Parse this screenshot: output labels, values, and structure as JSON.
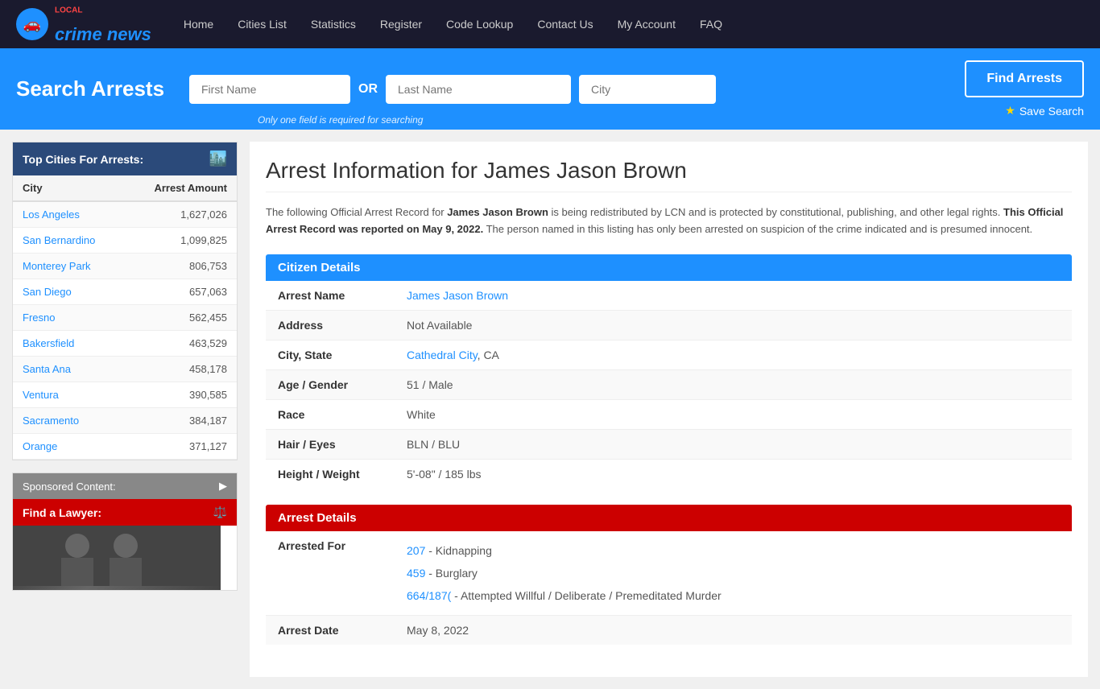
{
  "nav": {
    "logo_text": "crime news",
    "logo_local": "LOCAL",
    "links": [
      {
        "label": "Home",
        "href": "#"
      },
      {
        "label": "Cities List",
        "href": "#"
      },
      {
        "label": "Statistics",
        "href": "#"
      },
      {
        "label": "Register",
        "href": "#"
      },
      {
        "label": "Code Lookup",
        "href": "#"
      },
      {
        "label": "Contact Us",
        "href": "#"
      },
      {
        "label": "My Account",
        "href": "#"
      },
      {
        "label": "FAQ",
        "href": "#"
      }
    ]
  },
  "search": {
    "title": "Search Arrests",
    "first_name_placeholder": "First Name",
    "last_name_placeholder": "Last Name",
    "city_placeholder": "City",
    "or_label": "OR",
    "note": "Only one field is required for searching",
    "find_button": "Find Arrests",
    "save_label": "Save Search"
  },
  "sidebar": {
    "top_cities_header": "Top Cities For Arrests:",
    "col_city": "City",
    "col_amount": "Arrest Amount",
    "cities": [
      {
        "name": "Los Angeles",
        "amount": "1,627,026"
      },
      {
        "name": "San Bernardino",
        "amount": "1,099,825"
      },
      {
        "name": "Monterey Park",
        "amount": "806,753"
      },
      {
        "name": "San Diego",
        "amount": "657,063"
      },
      {
        "name": "Fresno",
        "amount": "562,455"
      },
      {
        "name": "Bakersfield",
        "amount": "463,529"
      },
      {
        "name": "Santa Ana",
        "amount": "458,178"
      },
      {
        "name": "Ventura",
        "amount": "390,585"
      },
      {
        "name": "Sacramento",
        "amount": "384,187"
      },
      {
        "name": "Orange",
        "amount": "371,127"
      }
    ],
    "sponsored_header": "Sponsored Content:",
    "find_lawyer": "Find a Lawyer:"
  },
  "main": {
    "page_title": "Arrest Information for James Jason Brown",
    "description_part1": "The following Official Arrest Record for ",
    "subject_name": "James Jason Brown",
    "description_part2": " is being redistributed by LCN and is protected by constitutional, publishing, and other legal rights. ",
    "report_notice": "This Official Arrest Record was reported on May 9, 2022.",
    "description_part3": " The person named in this listing has only been arrested on suspicion of the crime indicated and is presumed innocent.",
    "citizen_details_header": "Citizen Details",
    "arrest_details_header": "Arrest Details",
    "fields": {
      "arrest_name_label": "Arrest Name",
      "arrest_name_value": "James Jason Brown",
      "address_label": "Address",
      "address_value": "Not Available",
      "city_state_label": "City, State",
      "city_state_link": "Cathedral City",
      "city_state_rest": ", CA",
      "age_gender_label": "Age / Gender",
      "age_gender_value": "51 / Male",
      "race_label": "Race",
      "race_value": "White",
      "hair_eyes_label": "Hair / Eyes",
      "hair_eyes_value": "BLN / BLU",
      "height_weight_label": "Height / Weight",
      "height_weight_value": "5'-08\" / 185 lbs"
    },
    "arrest_fields": {
      "arrested_for_label": "Arrested For",
      "charges": [
        {
          "code": "207",
          "desc": "- Kidnapping"
        },
        {
          "code": "459",
          "desc": "- Burglary"
        },
        {
          "code": "664/187(",
          "desc": "- Attempted Willful / Deliberate / Premeditated Murder"
        }
      ],
      "arrest_date_label": "Arrest Date",
      "arrest_date_value": "May 8, 2022"
    }
  },
  "colors": {
    "nav_bg": "#1a1a2e",
    "blue": "#1e90ff",
    "red": "#cc0000",
    "link": "#1e90ff"
  }
}
